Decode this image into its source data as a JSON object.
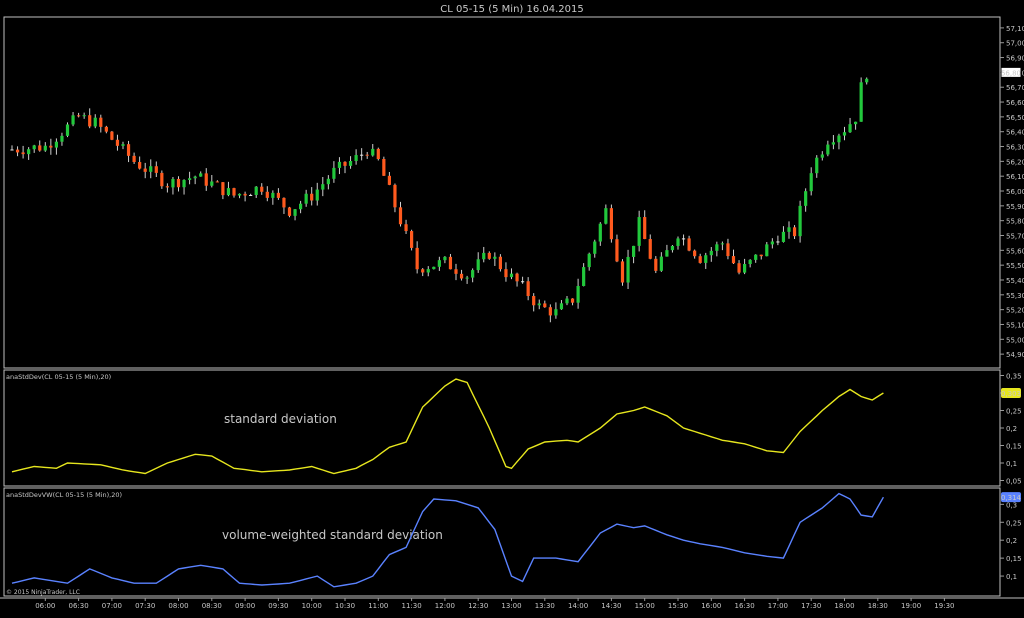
{
  "title": "CL 05-15 (5 Min)  16.04.2015",
  "copyright": "© 2015 NinjaTrader, LLC",
  "colors": {
    "up": "#22c83c",
    "down": "#ff5a1e",
    "doji": "#e6e6e6",
    "stddev": "#e6e61e",
    "stddev_vw": "#5a82ff",
    "axis": "#9a9a9a",
    "text": "#c8c8c8",
    "frame": "#c0c0c0"
  },
  "chart_data": [
    {
      "type": "candlestick",
      "title": "CL 05-15 (5 Min)  16.04.2015",
      "ylim": [
        54.82,
        57.16
      ],
      "y_ticks": [
        "57,10",
        "57,00",
        "56,90",
        "56,80",
        "56,70",
        "56,60",
        "56,50",
        "56,40",
        "56,30",
        "56,20",
        "56,10",
        "56,00",
        "55,90",
        "55,80",
        "55,70",
        "55,60",
        "55,50",
        "55,40",
        "55,30",
        "55,20",
        "55,10",
        "55,00",
        "54,90"
      ],
      "last_price_label": "56,80",
      "last_price": 56.8,
      "x_ticks": [
        "06:00",
        "06:30",
        "07:00",
        "07:30",
        "08:00",
        "08:30",
        "09:00",
        "09:30",
        "10:00",
        "10:30",
        "11:00",
        "11:30",
        "12:00",
        "12:30",
        "13:00",
        "13:30",
        "14:00",
        "14:30",
        "15:00",
        "15:30",
        "16:00",
        "16:30",
        "17:00",
        "17:30",
        "18:00",
        "18:30",
        "19:00",
        "19:30"
      ],
      "anchors": [
        [
          0,
          56.28
        ],
        [
          6,
          56.3
        ],
        [
          9,
          56.4
        ],
        [
          12,
          56.5
        ],
        [
          15,
          56.46
        ],
        [
          18,
          56.35
        ],
        [
          22,
          56.2
        ],
        [
          28,
          56.05
        ],
        [
          33,
          56.1
        ],
        [
          36,
          56.05
        ],
        [
          40,
          55.97
        ],
        [
          45,
          56.03
        ],
        [
          50,
          55.87
        ],
        [
          54,
          55.97
        ],
        [
          58,
          56.13
        ],
        [
          62,
          56.22
        ],
        [
          64,
          56.28
        ],
        [
          66,
          56.2
        ],
        [
          70,
          55.8
        ],
        [
          73,
          55.48
        ],
        [
          78,
          55.52
        ],
        [
          82,
          55.43
        ],
        [
          86,
          55.58
        ],
        [
          89,
          55.45
        ],
        [
          92,
          55.35
        ],
        [
          95,
          55.22
        ],
        [
          98,
          55.18
        ],
        [
          101,
          55.27
        ],
        [
          104,
          55.58
        ],
        [
          107,
          55.87
        ],
        [
          110,
          55.42
        ],
        [
          113,
          55.78
        ],
        [
          116,
          55.45
        ],
        [
          120,
          55.72
        ],
        [
          124,
          55.55
        ],
        [
          128,
          55.65
        ],
        [
          131,
          55.45
        ],
        [
          135,
          55.58
        ],
        [
          138,
          55.7
        ],
        [
          141,
          55.72
        ],
        [
          144,
          56.15
        ],
        [
          147,
          56.35
        ],
        [
          150,
          56.42
        ],
        [
          152,
          56.5
        ],
        [
          153,
          56.7
        ],
        [
          154,
          56.8
        ]
      ],
      "ohlc_note": "Candles (open, high, low, close) in price units are derived from the anchor path; x index = 5-minute bar number starting 06:00 minus 30 min."
    },
    {
      "type": "line",
      "title": "anaStdDev(CL 05-15 (5 Min),20)",
      "annotation": "standard deviation",
      "ylim": [
        0.04,
        0.36
      ],
      "y_ticks": [
        "0,35",
        "0,3",
        "0,25",
        "0,2",
        "0,15",
        "0,1",
        "0,05"
      ],
      "last_value_label": "0,303",
      "series": [
        {
          "values": [
            [
              0,
              0.075
            ],
            [
              4,
              0.09
            ],
            [
              8,
              0.085
            ],
            [
              10,
              0.1
            ],
            [
              16,
              0.095
            ],
            [
              20,
              0.08
            ],
            [
              24,
              0.07
            ],
            [
              28,
              0.1
            ],
            [
              33,
              0.125
            ],
            [
              36,
              0.12
            ],
            [
              40,
              0.085
            ],
            [
              45,
              0.075
            ],
            [
              50,
              0.08
            ],
            [
              54,
              0.09
            ],
            [
              58,
              0.07
            ],
            [
              62,
              0.085
            ],
            [
              65,
              0.11
            ],
            [
              68,
              0.145
            ],
            [
              71,
              0.16
            ],
            [
              74,
              0.26
            ],
            [
              78,
              0.32
            ],
            [
              80,
              0.34
            ],
            [
              82,
              0.33
            ],
            [
              86,
              0.2
            ],
            [
              89,
              0.09
            ],
            [
              90,
              0.085
            ],
            [
              93,
              0.14
            ],
            [
              96,
              0.16
            ],
            [
              100,
              0.165
            ],
            [
              102,
              0.16
            ],
            [
              106,
              0.2
            ],
            [
              109,
              0.24
            ],
            [
              112,
              0.25
            ],
            [
              114,
              0.26
            ],
            [
              118,
              0.235
            ],
            [
              121,
              0.2
            ],
            [
              124,
              0.185
            ],
            [
              128,
              0.165
            ],
            [
              132,
              0.155
            ],
            [
              136,
              0.135
            ],
            [
              139,
              0.13
            ],
            [
              142,
              0.19
            ],
            [
              146,
              0.25
            ],
            [
              149,
              0.29
            ],
            [
              151,
              0.31
            ],
            [
              153,
              0.29
            ],
            [
              155,
              0.28
            ],
            [
              157,
              0.3
            ]
          ]
        }
      ]
    },
    {
      "type": "line",
      "title": "anaStdDevVW(CL 05-15 (5 Min),20)",
      "annotation": "volume-weighted standard deviation",
      "ylim": [
        0.05,
        0.34
      ],
      "y_ticks": [
        "0,3",
        "0,25",
        "0,2",
        "0,15",
        "0,1"
      ],
      "last_value_label": "0,314",
      "series": [
        {
          "values": [
            [
              0,
              0.08
            ],
            [
              4,
              0.095
            ],
            [
              10,
              0.08
            ],
            [
              14,
              0.12
            ],
            [
              18,
              0.095
            ],
            [
              22,
              0.08
            ],
            [
              26,
              0.08
            ],
            [
              30,
              0.12
            ],
            [
              34,
              0.13
            ],
            [
              38,
              0.12
            ],
            [
              41,
              0.08
            ],
            [
              45,
              0.075
            ],
            [
              50,
              0.08
            ],
            [
              55,
              0.1
            ],
            [
              58,
              0.07
            ],
            [
              62,
              0.08
            ],
            [
              65,
              0.1
            ],
            [
              68,
              0.16
            ],
            [
              71,
              0.18
            ],
            [
              74,
              0.28
            ],
            [
              76,
              0.315
            ],
            [
              80,
              0.31
            ],
            [
              84,
              0.29
            ],
            [
              87,
              0.23
            ],
            [
              90,
              0.1
            ],
            [
              92,
              0.085
            ],
            [
              94,
              0.15
            ],
            [
              98,
              0.15
            ],
            [
              102,
              0.14
            ],
            [
              106,
              0.22
            ],
            [
              109,
              0.245
            ],
            [
              112,
              0.235
            ],
            [
              114,
              0.24
            ],
            [
              118,
              0.215
            ],
            [
              121,
              0.2
            ],
            [
              124,
              0.19
            ],
            [
              128,
              0.18
            ],
            [
              132,
              0.165
            ],
            [
              136,
              0.155
            ],
            [
              139,
              0.15
            ],
            [
              142,
              0.25
            ],
            [
              146,
              0.29
            ],
            [
              149,
              0.33
            ],
            [
              151,
              0.315
            ],
            [
              153,
              0.27
            ],
            [
              155,
              0.265
            ],
            [
              157,
              0.32
            ]
          ]
        }
      ]
    }
  ]
}
